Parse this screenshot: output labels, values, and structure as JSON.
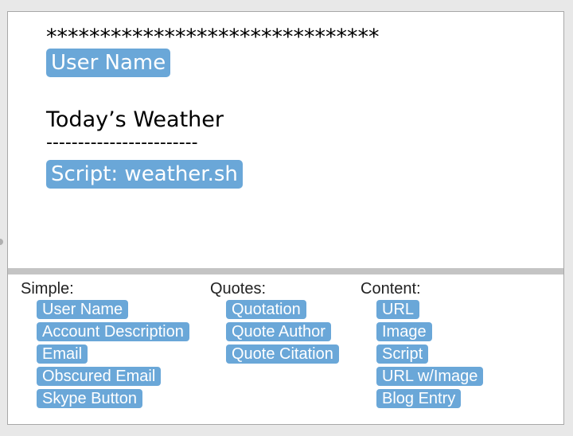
{
  "editor": {
    "asterisks": "*******************************",
    "user_name_token": "User Name",
    "heading": "Today’s Weather",
    "dashes": "------------------------",
    "script_token": "Script: weather.sh"
  },
  "palette": {
    "simple": {
      "title": "Simple:",
      "items": [
        "User Name",
        "Account Description",
        "Email",
        "Obscured Email",
        "Skype Button"
      ]
    },
    "quotes": {
      "title": "Quotes:",
      "items": [
        "Quotation",
        "Quote Author",
        "Quote Citation"
      ]
    },
    "content": {
      "title": "Content:",
      "items": [
        "URL",
        "Image",
        "Script",
        "URL w/Image",
        "Blog Entry"
      ]
    }
  },
  "colors": {
    "token": "#6aa7d8",
    "divider": "#c4c4c4",
    "background": "#e8e8e8"
  }
}
